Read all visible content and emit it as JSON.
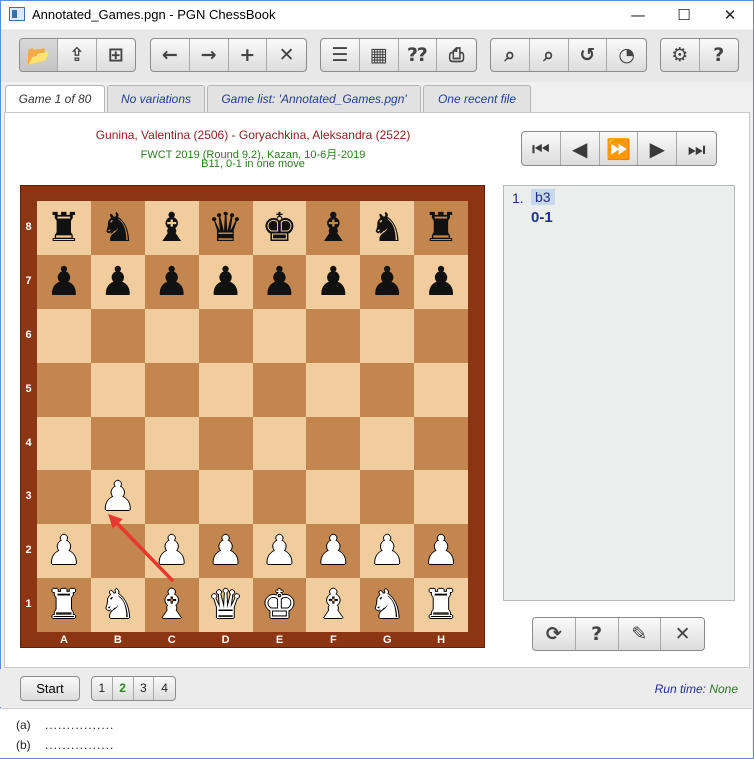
{
  "window": {
    "title": "Annotated_Games.pgn - PGN ChessBook",
    "controls": {
      "minimize": "—",
      "maximize": "☐",
      "close": "✕"
    }
  },
  "toolbar": {
    "groups": [
      {
        "name": "file",
        "buttons": [
          {
            "icon": "open-folder-icon",
            "glyph": "📂"
          },
          {
            "icon": "export-icon",
            "glyph": "⇪"
          },
          {
            "icon": "new-file-icon",
            "glyph": "⊞"
          }
        ]
      },
      {
        "name": "edit",
        "buttons": [
          {
            "icon": "arrow-left-icon",
            "glyph": "←"
          },
          {
            "icon": "arrow-right-icon",
            "glyph": "→"
          },
          {
            "icon": "plus-icon",
            "glyph": "+"
          },
          {
            "icon": "delete-icon",
            "glyph": "✕"
          }
        ]
      },
      {
        "name": "tools",
        "buttons": [
          {
            "icon": "player-list-icon",
            "glyph": "☰"
          },
          {
            "icon": "board-icon",
            "glyph": "▦"
          },
          {
            "icon": "annotation-search-icon",
            "glyph": "⁇"
          },
          {
            "icon": "print-icon",
            "glyph": "⎙"
          }
        ]
      },
      {
        "name": "analysis",
        "buttons": [
          {
            "icon": "search-icon",
            "glyph": "⌕"
          },
          {
            "icon": "zoom-search-icon",
            "glyph": "⌕"
          },
          {
            "icon": "undo-search-icon",
            "glyph": "↺"
          },
          {
            "icon": "pie-chart-icon",
            "glyph": "◔"
          }
        ]
      },
      {
        "name": "app",
        "buttons": [
          {
            "icon": "settings-gear-icon",
            "glyph": "⚙"
          },
          {
            "icon": "help-book-icon",
            "glyph": "?"
          }
        ]
      }
    ]
  },
  "tabs": [
    {
      "label": "Game 1 of 80",
      "active": true
    },
    {
      "label": "No variations",
      "active": false
    },
    {
      "label": "Game list:  'Annotated_Games.pgn'",
      "active": false
    },
    {
      "label": "One recent file",
      "active": false
    }
  ],
  "game": {
    "players": "Gunina, Valentina (2506) - Goryachkina, Aleksandra (2522)",
    "event": "FWCT 2019 (Round 9.2),  Kazan,  10-6月-2019",
    "eco": "B11,  0-1  in one move"
  },
  "navigation": [
    {
      "icon": "first-move-icon",
      "glyph": "⏮"
    },
    {
      "icon": "previous-move-icon",
      "glyph": "◀"
    },
    {
      "icon": "fast-forward-icon",
      "glyph": "⏩"
    },
    {
      "icon": "next-move-icon",
      "glyph": "▶"
    },
    {
      "icon": "last-move-icon",
      "glyph": "⏭"
    }
  ],
  "board": {
    "ranks": [
      "8",
      "7",
      "6",
      "5",
      "4",
      "3",
      "2",
      "1"
    ],
    "files": [
      "A",
      "B",
      "C",
      "D",
      "E",
      "F",
      "G",
      "H"
    ],
    "position": [
      "rnbqkbnr",
      "pppppppp",
      "........",
      "........",
      "........",
      ".P......",
      "P.PPPPPP",
      "RNBQKBNR"
    ],
    "last_move": {
      "from": "c1",
      "to": "b3"
    },
    "arrow_color": "#e8382e"
  },
  "moves": {
    "number": "1.",
    "san": "b3",
    "result": "0-1"
  },
  "edit_buttons": [
    {
      "icon": "refresh-icon",
      "glyph": "⟳"
    },
    {
      "icon": "player-help-icon",
      "glyph": "?"
    },
    {
      "icon": "edit-note-icon",
      "glyph": "✎"
    },
    {
      "icon": "close-icon",
      "glyph": "✕"
    }
  ],
  "bottom": {
    "start_label": "Start",
    "pages": [
      "1",
      "2",
      "3",
      "4"
    ],
    "current_page": "2",
    "runtime_label": "Run time: ",
    "runtime_value": "None"
  },
  "notes": [
    {
      "label": "(a)",
      "dots": "................"
    },
    {
      "label": "(b)",
      "dots": "................"
    }
  ]
}
